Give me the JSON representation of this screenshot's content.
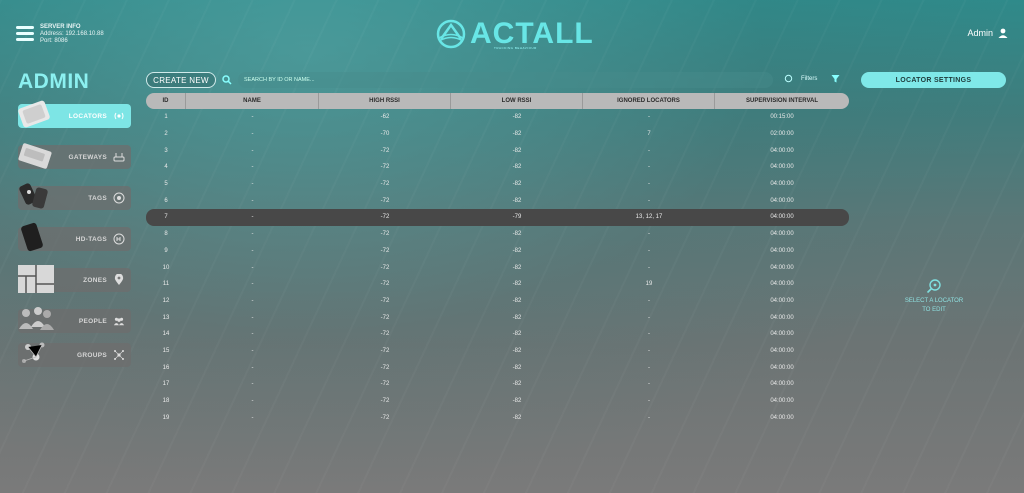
{
  "header": {
    "server_info_title": "SERVER INFO",
    "server_address": "Address: 192.168.10.88",
    "server_port": "Port: 8086",
    "logo_text": "ACTALL",
    "logo_tagline": "TRACKING BEHAVIOUR",
    "user_name": "Admin"
  },
  "sidebar": {
    "title": "ADMIN",
    "items": [
      {
        "label": "LOCATORS",
        "icon": "broadcast-icon",
        "active": true
      },
      {
        "label": "GATEWAYS",
        "icon": "router-icon",
        "active": false
      },
      {
        "label": "TAGS",
        "icon": "target-icon",
        "active": false
      },
      {
        "label": "HD-TAGS",
        "icon": "hd-tag-icon",
        "active": false
      },
      {
        "label": "ZONES",
        "icon": "location-pin-icon",
        "active": false
      },
      {
        "label": "PEOPLE",
        "icon": "people-icon",
        "active": false
      },
      {
        "label": "GROUPS",
        "icon": "network-icon",
        "active": false
      }
    ]
  },
  "toolbar": {
    "create_label": "CREATE NEW",
    "search_placeholder": "SEARCH BY ID OR NAME...",
    "filters_label": "Filters",
    "settings_label": "LOCATOR SETTINGS"
  },
  "table": {
    "columns": [
      "ID",
      "NAME",
      "HIGH RSSI",
      "LOW RSSI",
      "IGNORED LOCATORS",
      "SUPERVISION INTERVAL"
    ],
    "selected_row": 7,
    "rows": [
      [
        "1",
        "-",
        "-62",
        "-82",
        "-",
        "00:15:00"
      ],
      [
        "2",
        "-",
        "-70",
        "-82",
        "7",
        "02:00:00"
      ],
      [
        "3",
        "-",
        "-72",
        "-82",
        "-",
        "04:00:00"
      ],
      [
        "4",
        "-",
        "-72",
        "-82",
        "-",
        "04:00:00"
      ],
      [
        "5",
        "-",
        "-72",
        "-82",
        "-",
        "04:00:00"
      ],
      [
        "6",
        "-",
        "-72",
        "-82",
        "-",
        "04:00:00"
      ],
      [
        "7",
        "-",
        "-72",
        "-79",
        "13, 12, 17",
        "04:00:00"
      ],
      [
        "8",
        "-",
        "-72",
        "-82",
        "-",
        "04:00:00"
      ],
      [
        "9",
        "-",
        "-72",
        "-82",
        "-",
        "04:00:00"
      ],
      [
        "10",
        "-",
        "-72",
        "-82",
        "-",
        "04:00:00"
      ],
      [
        "11",
        "-",
        "-72",
        "-82",
        "19",
        "04:00:00"
      ],
      [
        "12",
        "-",
        "-72",
        "-82",
        "-",
        "04:00:00"
      ],
      [
        "13",
        "-",
        "-72",
        "-82",
        "-",
        "04:00:00"
      ],
      [
        "14",
        "-",
        "-72",
        "-82",
        "-",
        "04:00:00"
      ],
      [
        "15",
        "-",
        "-72",
        "-82",
        "-",
        "04:00:00"
      ],
      [
        "16",
        "-",
        "-72",
        "-82",
        "-",
        "04:00:00"
      ],
      [
        "17",
        "-",
        "-72",
        "-82",
        "-",
        "04:00:00"
      ],
      [
        "18",
        "-",
        "-72",
        "-82",
        "-",
        "04:00:00"
      ],
      [
        "19",
        "-",
        "-72",
        "-82",
        "-",
        "04:00:00"
      ]
    ]
  },
  "detail_panel": {
    "empty_line1": "SELECT A LOCATOR",
    "empty_line2": "TO EDIT"
  },
  "colors": {
    "accent": "#7fe8e8",
    "selected_row": "#484848"
  }
}
